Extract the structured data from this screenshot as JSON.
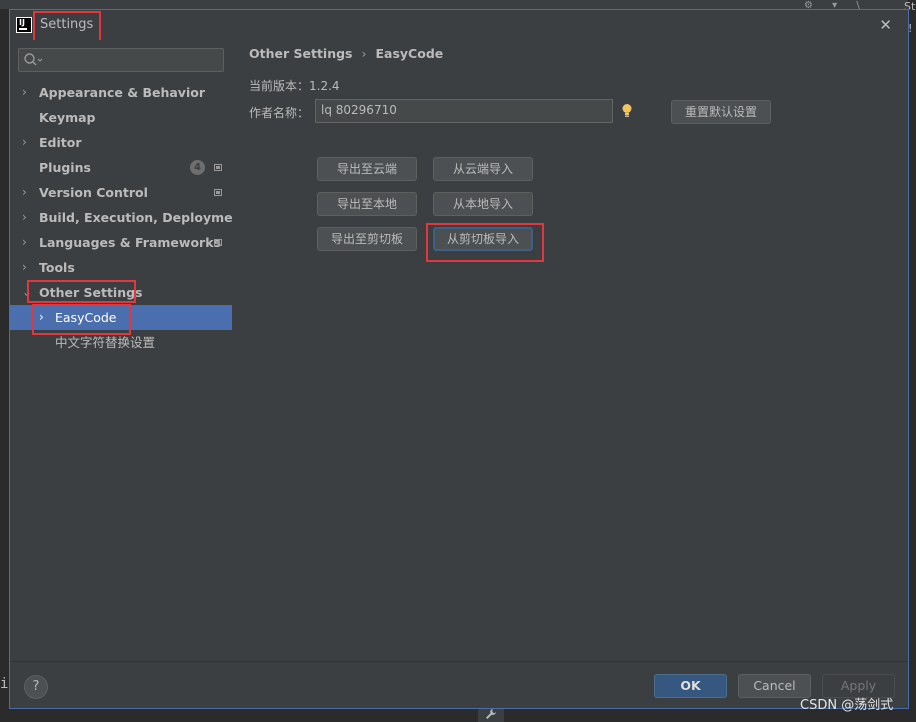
{
  "dialog": {
    "title": "Settings",
    "close_glyph": "✕",
    "logo_text": "IJ"
  },
  "background": {
    "right_text_top": "St",
    "right_text_mid": "!",
    "left_char": "i",
    "wrench_glyph": "🔧",
    "top_icons": "⚙ ▾ \\"
  },
  "sidebar": {
    "search_placeholder": "",
    "items": [
      {
        "label": "Appearance & Behavior",
        "arrow": "›"
      },
      {
        "label": "Keymap",
        "arrow": ""
      },
      {
        "label": "Editor",
        "arrow": "›"
      },
      {
        "label": "Plugins",
        "arrow": "",
        "badge": "4"
      },
      {
        "label": "Version Control",
        "arrow": "›"
      },
      {
        "label": "Build, Execution, Deployment",
        "arrow": "›"
      },
      {
        "label": "Languages & Frameworks",
        "arrow": "›"
      },
      {
        "label": "Tools",
        "arrow": "›"
      },
      {
        "label": "Other Settings",
        "arrow": "⌄"
      },
      {
        "label": "EasyCode",
        "arrow": "›"
      },
      {
        "label": "中文字符替换设置",
        "arrow": ""
      }
    ]
  },
  "main": {
    "breadcrumb": {
      "parent": "Other Settings",
      "separator": "›",
      "current": "EasyCode"
    },
    "version_label": "当前版本：",
    "version_value": "1.2.4",
    "author_label": "作者名称：",
    "author_value": "lq 80296710",
    "reset_button": "重置默认设置",
    "buttons": {
      "export_cloud": "导出至云端",
      "import_cloud": "从云端导入",
      "export_local": "导出至本地",
      "import_local": "从本地导入",
      "export_clipboard": "导出至剪切板",
      "import_clipboard": "从剪切板导入"
    }
  },
  "footer": {
    "help": "?",
    "ok": "OK",
    "cancel": "Cancel",
    "apply": "Apply"
  },
  "watermark": "CSDN @荡剑式",
  "colors": {
    "accent": "#4b6eaf",
    "highlight": "#e0383e",
    "ok_button": "#365880"
  }
}
